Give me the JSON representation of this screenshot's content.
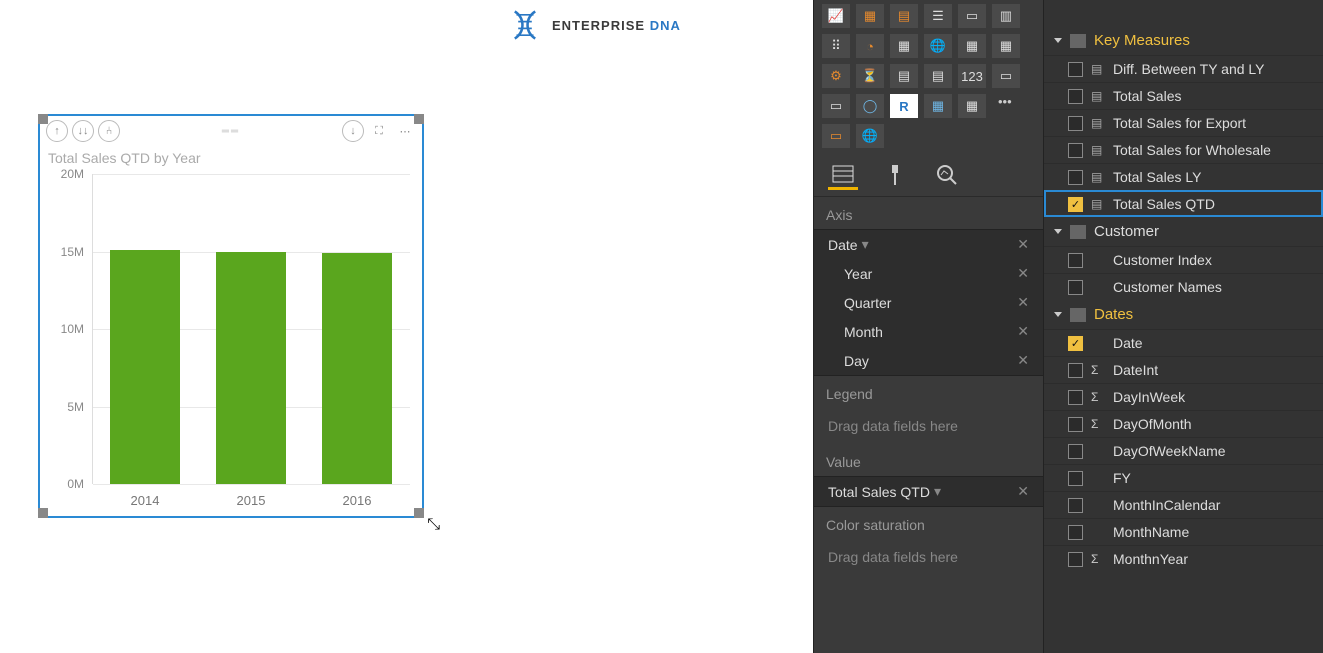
{
  "logo": {
    "text1": "ENTERPRISE",
    "text2": "DNA"
  },
  "chart_data": {
    "type": "bar",
    "title": "Total Sales QTD by Year",
    "categories": [
      "2014",
      "2015",
      "2016"
    ],
    "values": [
      15.1,
      15.0,
      14.9
    ],
    "ylabel": "",
    "xlabel": "",
    "ylim": [
      0,
      20
    ],
    "y_ticks": [
      "0M",
      "5M",
      "10M",
      "15M",
      "20M"
    ],
    "bar_color": "#5aa61e"
  },
  "viz_panel": {
    "tabs": {
      "fields": "fields",
      "format": "format",
      "analytics": "analytics"
    },
    "wells": {
      "axis": {
        "label": "Axis",
        "main": "Date",
        "hierarchy": [
          "Year",
          "Quarter",
          "Month",
          "Day"
        ]
      },
      "legend": {
        "label": "Legend",
        "placeholder": "Drag data fields here"
      },
      "value": {
        "label": "Value",
        "item": "Total Sales QTD"
      },
      "color": {
        "label": "Color saturation",
        "placeholder": "Drag data fields here"
      }
    }
  },
  "fields_panel": {
    "groups": [
      {
        "name": "Key Measures",
        "highlight": true,
        "icon": "calc",
        "fields": [
          {
            "label": "Diff. Between TY and LY",
            "checked": false,
            "kind": "measure"
          },
          {
            "label": "Total Sales",
            "checked": false,
            "kind": "measure"
          },
          {
            "label": "Total Sales for Export",
            "checked": false,
            "kind": "measure"
          },
          {
            "label": "Total Sales for Wholesale",
            "checked": false,
            "kind": "measure"
          },
          {
            "label": "Total Sales LY",
            "checked": false,
            "kind": "measure"
          },
          {
            "label": "Total Sales QTD",
            "checked": true,
            "kind": "measure",
            "selected": true
          }
        ]
      },
      {
        "name": "Customer",
        "highlight": false,
        "icon": "table",
        "fields": [
          {
            "label": "Customer Index",
            "checked": false,
            "kind": "column"
          },
          {
            "label": "Customer Names",
            "checked": false,
            "kind": "column"
          }
        ]
      },
      {
        "name": "Dates",
        "highlight": true,
        "icon": "table",
        "fields": [
          {
            "label": "Date",
            "checked": true,
            "kind": "column"
          },
          {
            "label": "DateInt",
            "checked": false,
            "kind": "sigma"
          },
          {
            "label": "DayInWeek",
            "checked": false,
            "kind": "sigma"
          },
          {
            "label": "DayOfMonth",
            "checked": false,
            "kind": "sigma"
          },
          {
            "label": "DayOfWeekName",
            "checked": false,
            "kind": "column"
          },
          {
            "label": "FY",
            "checked": false,
            "kind": "column"
          },
          {
            "label": "MonthInCalendar",
            "checked": false,
            "kind": "column"
          },
          {
            "label": "MonthName",
            "checked": false,
            "kind": "column"
          },
          {
            "label": "MonthnYear",
            "checked": false,
            "kind": "sigma"
          }
        ]
      }
    ]
  }
}
